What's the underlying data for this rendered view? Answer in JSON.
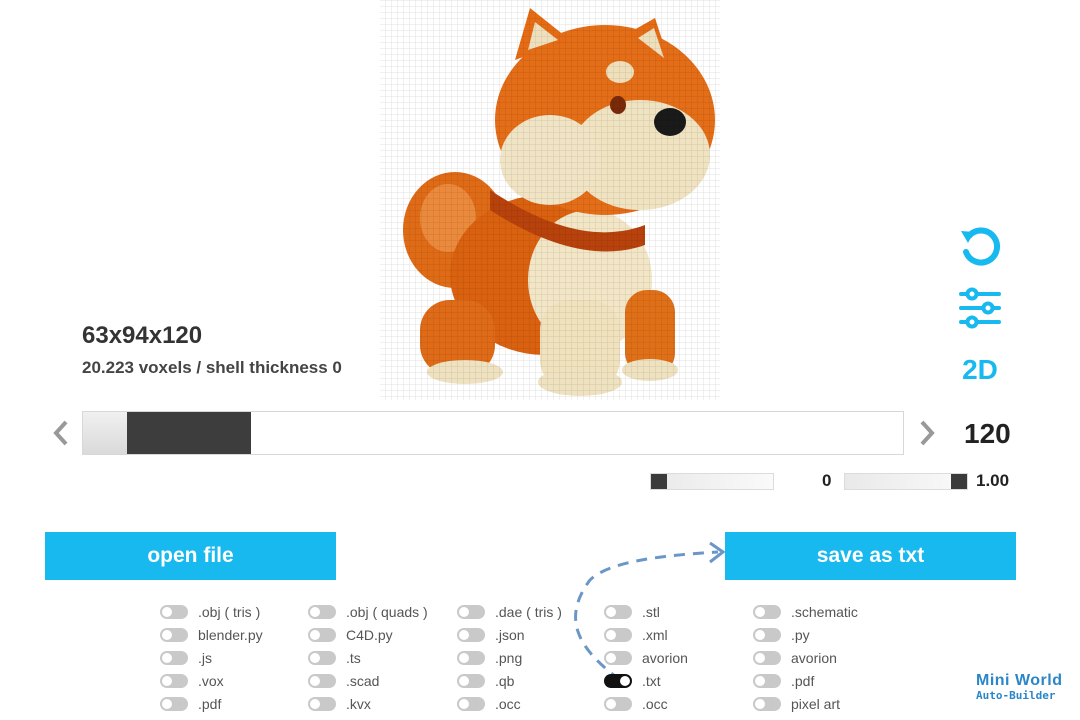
{
  "model": {
    "dimensions": "63x94x120",
    "info": "20.223 voxels / shell thickness 0"
  },
  "icons": {
    "rotate": "rotate-icon",
    "settings": "sliders-icon",
    "view2d": "2d-view-icon",
    "prev": "chevron-left-icon",
    "next": "chevron-right-icon"
  },
  "view2d_label": "2D",
  "layer": {
    "value": "120"
  },
  "shell_slider": {
    "fraction": 0.0
  },
  "scale_slider": {
    "min_label": "0",
    "max_label": "1.00",
    "fraction": 1.0
  },
  "buttons": {
    "open": "open file",
    "save": "save as txt"
  },
  "colors": {
    "accent": "#17b9ef",
    "arrow": "#6a97c7",
    "toggle_off": "#c9c9c9",
    "toggle_on": "#111111"
  },
  "formats": [
    [
      ".obj ( tris )",
      "blender.py",
      ".js",
      ".vox",
      ".pdf"
    ],
    [
      ".obj ( quads )",
      "C4D.py",
      ".ts",
      ".scad",
      ".kvx"
    ],
    [
      ".dae ( tris )",
      ".json",
      ".png",
      ".qb",
      ".occ"
    ],
    [
      ".stl",
      ".xml",
      "avorion",
      ".txt",
      ".occ"
    ],
    [
      ".schematic",
      ".py",
      "avorion",
      ".pdf",
      "pixel art"
    ]
  ],
  "selected_format": {
    "column": 3,
    "row": 3
  },
  "watermark": {
    "line1": "Mini World",
    "line2": "Auto-Builder"
  }
}
